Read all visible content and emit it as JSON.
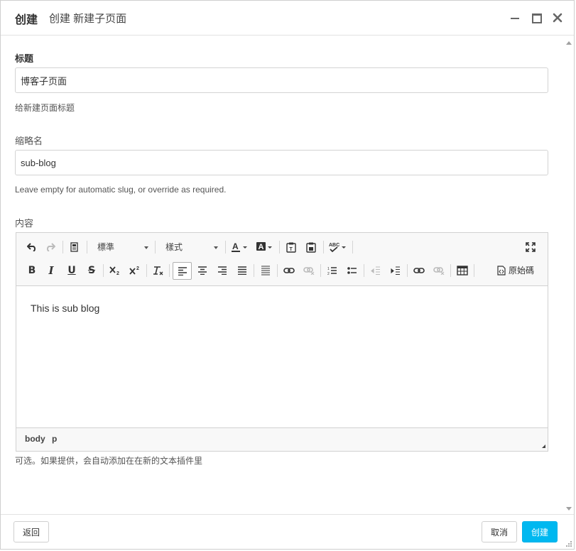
{
  "header": {
    "title": "创建",
    "subtitle": "创建 新建子页面"
  },
  "form": {
    "title_label": "标题",
    "title_value": "博客子页面",
    "title_help": "给新建页面标题",
    "slug_label": "缩略名",
    "slug_value": "sub-blog",
    "slug_help": "Leave empty for automatic slug, or override as required.",
    "content_label": "内容",
    "content_help": "可选。如果提供，会自动添加在在新的文本插件里"
  },
  "editor": {
    "format_combo": "標準",
    "style_combo": "樣式",
    "source_label": "原始碼",
    "content_text": "This is sub blog",
    "path": [
      "body",
      "p"
    ]
  },
  "footer": {
    "back_label": "返回",
    "cancel_label": "取消",
    "create_label": "创建"
  },
  "colors": {
    "primary": "#00b8f0"
  }
}
